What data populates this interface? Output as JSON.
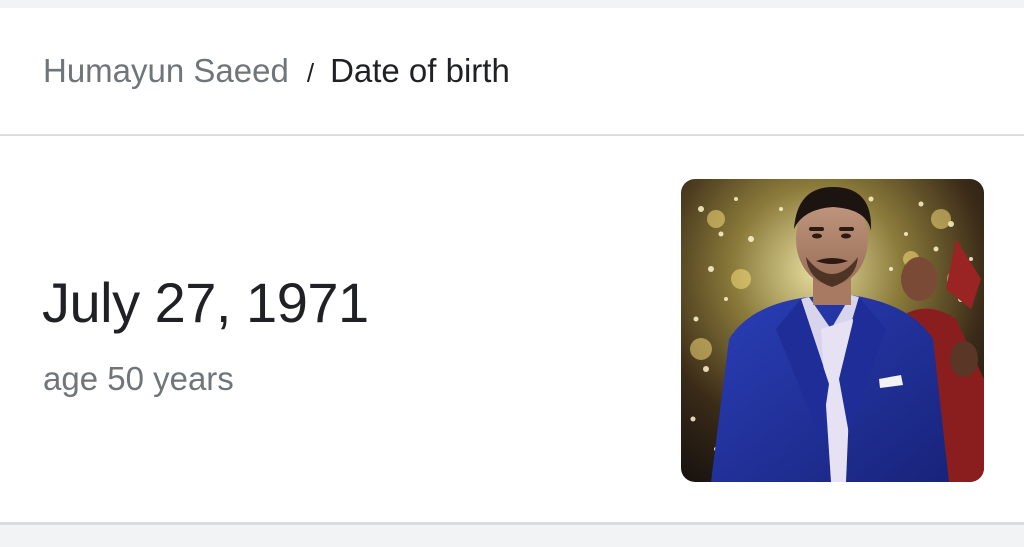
{
  "breadcrumb": {
    "parent": "Humayun Saeed",
    "separator": "/",
    "current": "Date of birth"
  },
  "answer": {
    "date": "July 27, 1971",
    "age": "age 50 years"
  },
  "thumbnail": {
    "alt": "Humayun Saeed"
  }
}
